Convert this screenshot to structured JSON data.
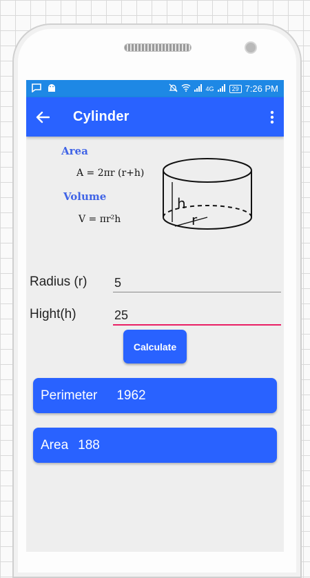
{
  "status_bar": {
    "battery": "29",
    "time": "7:26 PM",
    "network": "4G"
  },
  "app_bar": {
    "title": "Cylinder"
  },
  "formulas": {
    "area_label": "Area",
    "area_formula": "A = 2πr (r+h)",
    "volume_label": "Volume",
    "volume_formula": "V = πr²h",
    "diagram_height_label": "h",
    "diagram_radius_label": "r"
  },
  "form": {
    "radius_label": "Radius (r)",
    "radius_value": "5",
    "height_label": "Hight(h)",
    "height_value": "25",
    "calculate_label": "Calculate"
  },
  "results": {
    "perimeter_label": "Perimeter",
    "perimeter_value": "1962",
    "area_label": "Area",
    "area_value": "188"
  },
  "colors": {
    "app_bar": "#2962ff",
    "status_bar": "#1e88e5",
    "formula_label": "#3f63e6",
    "active_underline": "#e91e63"
  }
}
